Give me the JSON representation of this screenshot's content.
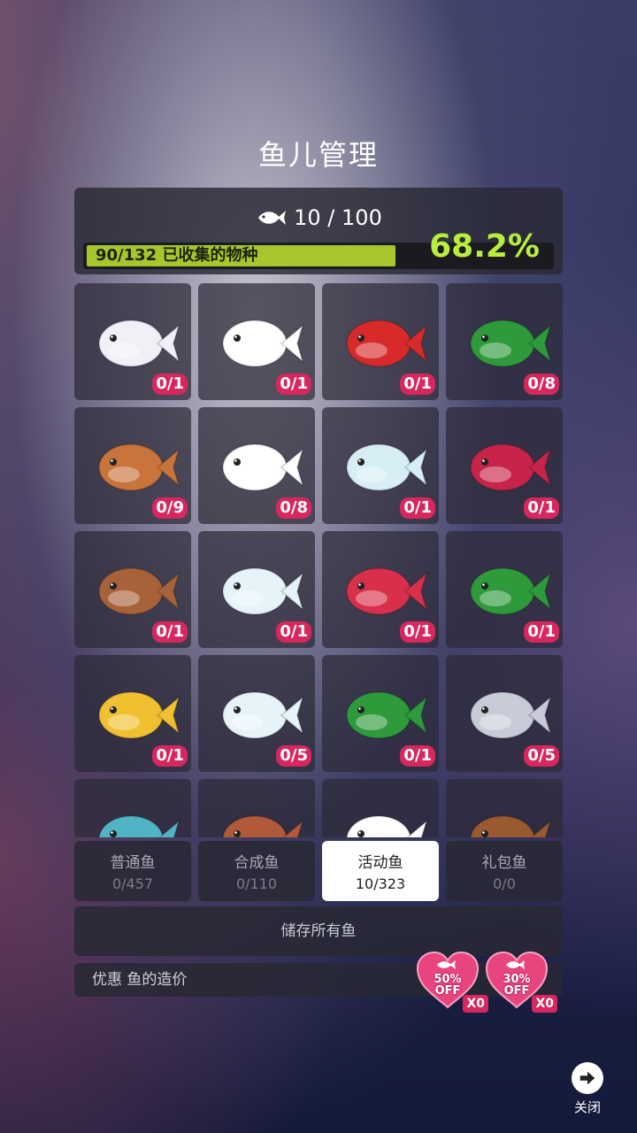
{
  "title": "鱼儿管理",
  "stats": {
    "fish_count": "10 / 100",
    "progress_label": "90/132 已收集的物种",
    "progress_fraction": 0.682,
    "percent": "68.2%"
  },
  "fish": [
    {
      "name": "axolotl",
      "count": "0/1",
      "color": "#f2f0f6"
    },
    {
      "name": "lucky-cat-fish",
      "count": "0/1",
      "color": "#ffffff"
    },
    {
      "name": "lantern-jellyfish",
      "count": "0/1",
      "color": "#d82a2a"
    },
    {
      "name": "holly-frog",
      "count": "0/8",
      "color": "#2e9a3c"
    },
    {
      "name": "reindeer-puffer",
      "count": "0/9",
      "color": "#c8743a"
    },
    {
      "name": "snowman-goldfish",
      "count": "0/8",
      "color": "#ffffff"
    },
    {
      "name": "snow-whale",
      "count": "0/1",
      "color": "#d6eef4"
    },
    {
      "name": "santa-fish",
      "count": "0/1",
      "color": "#c8244a"
    },
    {
      "name": "reindeer-pufferfish",
      "count": "0/1",
      "color": "#a8623a"
    },
    {
      "name": "snow-blob-fish",
      "count": "0/1",
      "color": "#e6f4fa"
    },
    {
      "name": "stocking-axolotl",
      "count": "0/1",
      "color": "#d8304a"
    },
    {
      "name": "holly-seahorse",
      "count": "0/1",
      "color": "#2e9a3c"
    },
    {
      "name": "bell-squid",
      "count": "0/1",
      "color": "#f0c030"
    },
    {
      "name": "snowflake-whale",
      "count": "0/5",
      "color": "#e6f4fa"
    },
    {
      "name": "holly-swordfish",
      "count": "0/1",
      "color": "#2e9a3c"
    },
    {
      "name": "crystal-jellyfish",
      "count": "0/5",
      "color": "#c8ccd8"
    },
    {
      "name": "snowglobe-turtle",
      "count": "",
      "color": "#50b4c4"
    },
    {
      "name": "antler-fish",
      "count": "",
      "color": "#b05a3a"
    },
    {
      "name": "snowman-bird-fish",
      "count": "",
      "color": "#ffffff"
    },
    {
      "name": "reindeer-manta",
      "count": "",
      "color": "#9a5a30"
    }
  ],
  "tabs": [
    {
      "name": "普通鱼",
      "count": "0/457"
    },
    {
      "name": "合成鱼",
      "count": "0/110"
    },
    {
      "name": "活动鱼",
      "count": "10/323"
    },
    {
      "name": "礼包鱼",
      "count": "0/0"
    }
  ],
  "active_tab": 2,
  "store_all": "储存所有鱼",
  "discount": {
    "label": "优惠 鱼的造价",
    "coupons": [
      {
        "percent": "50%",
        "off": "OFF",
        "qty": "X0"
      },
      {
        "percent": "30%",
        "off": "OFF",
        "qty": "X0"
      }
    ]
  },
  "close": "关闭",
  "colors": {
    "accent_green": "#b8ee3c",
    "badge_pink": "#d8275e",
    "bar_fill": "#a6c62c"
  }
}
